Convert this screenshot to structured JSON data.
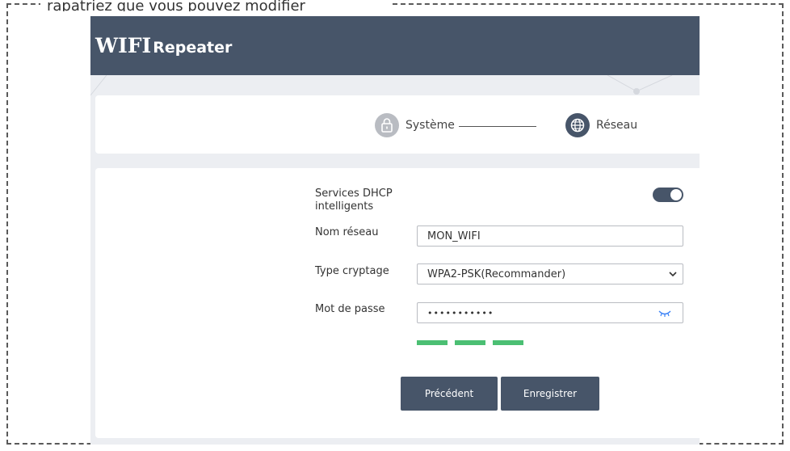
{
  "caption": "rapatriez que vous pouvez modifier",
  "header": {
    "brand_main": "WIFI",
    "brand_sub": "Repeater"
  },
  "steps": [
    {
      "label": "Système",
      "icon": "lock-icon",
      "state": "done"
    },
    {
      "label": "Réseau",
      "icon": "globe-icon",
      "state": "active"
    }
  ],
  "form": {
    "dhcp_label_1": "Services DHCP",
    "dhcp_label_2": "intelligents",
    "dhcp_enabled": true,
    "network_name_label": "Nom réseau",
    "network_name_value": "MON_WIFI",
    "encryption_label": "Type cryptage",
    "encryption_value": "WPA2-PSK(Recommander)",
    "password_label": "Mot de passe",
    "password_value": "•••••••••••",
    "password_strength_bars": 3
  },
  "buttons": {
    "previous": "Précédent",
    "save": "Enregistrer"
  },
  "colors": {
    "primary": "#475569",
    "strength": "#4bbf73",
    "inactive_step": "#b9bcc2"
  }
}
